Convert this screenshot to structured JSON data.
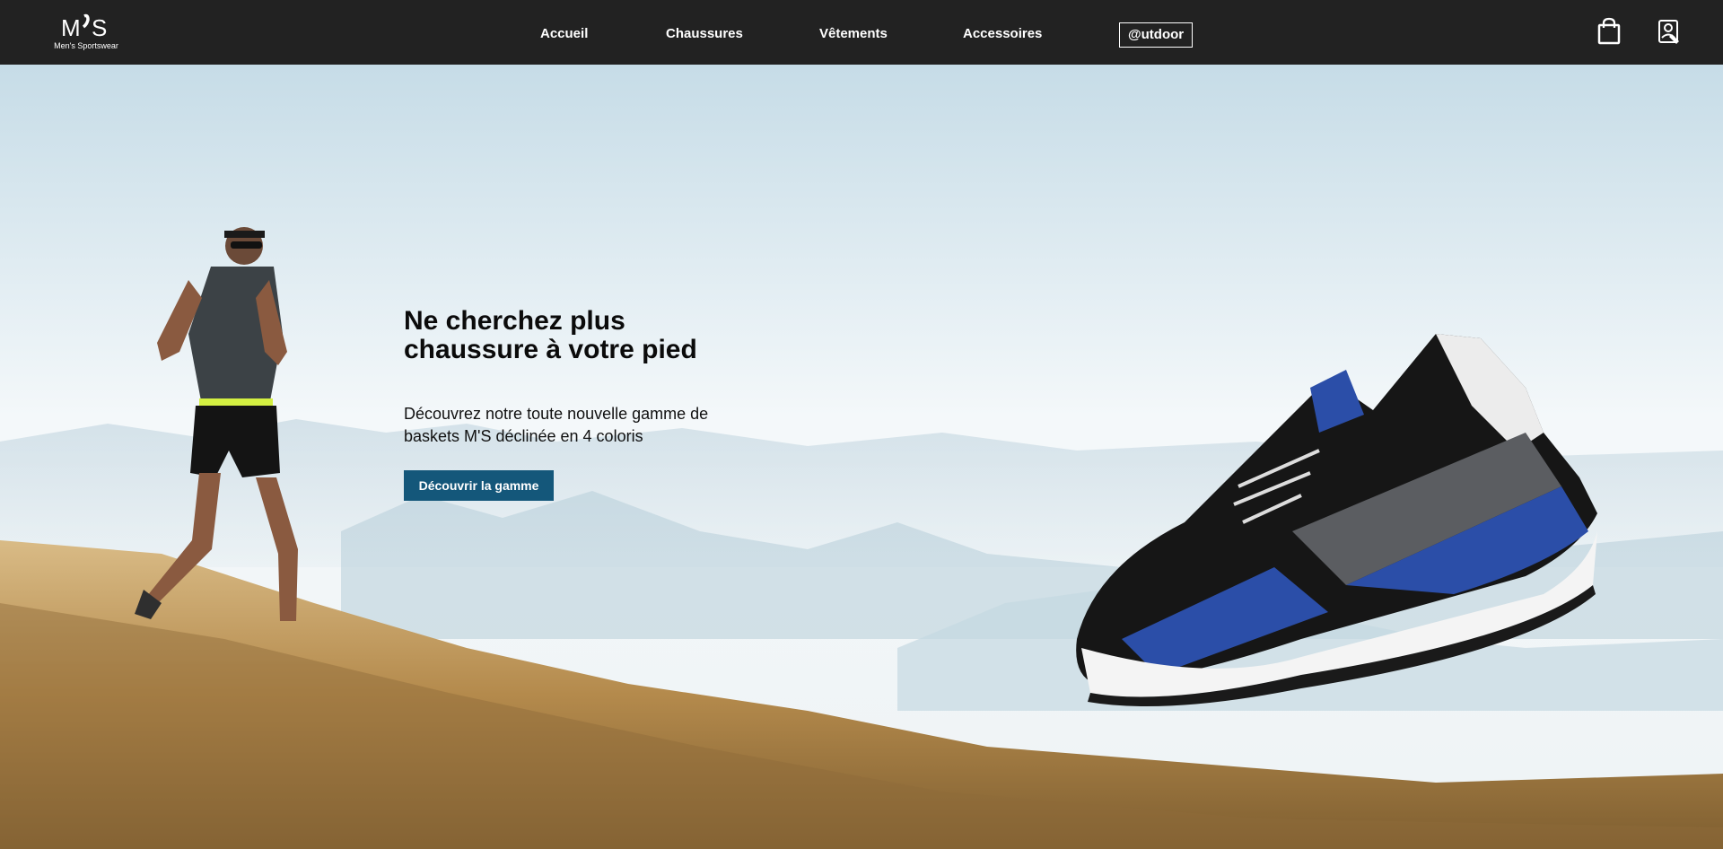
{
  "brand": {
    "logo_mark": "M’S",
    "tagline": "Men's Sportswear",
    "logo_icon": "ms-logo-icon"
  },
  "nav": {
    "items": [
      {
        "label": "Accueil"
      },
      {
        "label": "Chaussures"
      },
      {
        "label": "Vêtements"
      },
      {
        "label": "Accessoires"
      },
      {
        "label": "@utdoor"
      }
    ]
  },
  "header_actions": {
    "bag_icon": "shopping-bag-icon",
    "user_icon": "user-id-icon"
  },
  "hero": {
    "title_line1": "Ne cherchez plus",
    "title_line2": "chaussure à votre pied",
    "text_line1": "Découvrez notre toute nouvelle gamme de",
    "text_line2": "baskets M'S déclinée en 4 coloris",
    "cta_label": "Découvrir la gamme"
  },
  "colors": {
    "header_bg": "#222222",
    "accent": "#14577a",
    "text": "#0b0b0b"
  }
}
